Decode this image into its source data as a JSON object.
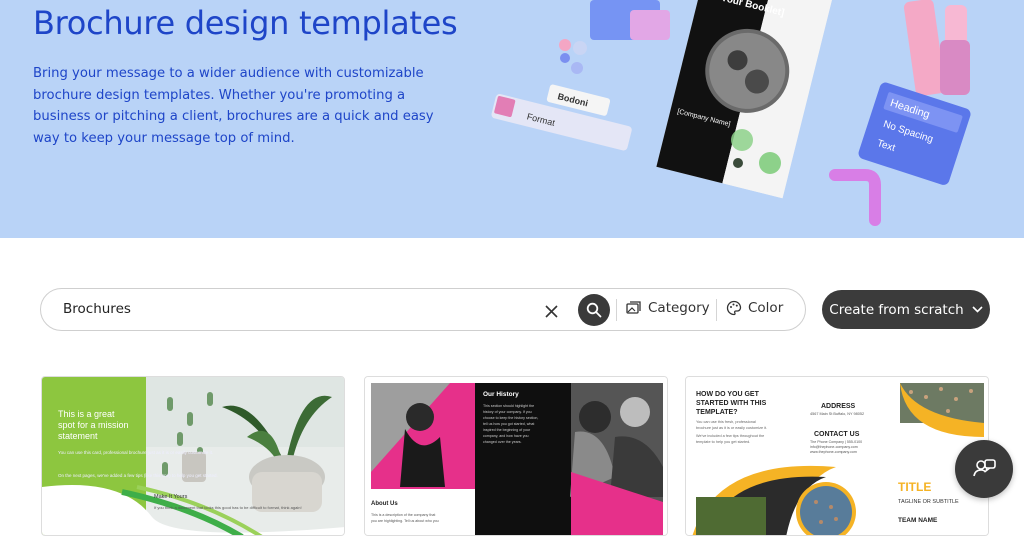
{
  "hero": {
    "title": "Brochure design templates",
    "description": "Bring your message to a wider audience with customizable brochure design templates. Whether you're promoting a business or pitching a client, brochures are a quick and easy way to keep your message top of mind.",
    "art": {
      "booklet_title": "of Your Booklet]",
      "company": "[Company Name]",
      "toolbar_label": "Format",
      "font_label": "Bodoni",
      "styles": [
        "Heading",
        "No Spacing",
        "Text"
      ]
    }
  },
  "search": {
    "value": "Brochures",
    "category_label": "Category",
    "color_label": "Color"
  },
  "create_button": "Create from scratch",
  "templates": [
    {
      "name": "green-brochure",
      "headline": "This is a great spot for a mission statement",
      "body": "You can use this card, professional brochure just as it is or easily customize it.",
      "body2": "On the next pages, we've added a few tips (like this one) to help you get started.",
      "caption": "Make It Yours",
      "caption_body": "If you think a document that looks this good has to be difficult to format, think again!"
    },
    {
      "name": "pink-black-brochure",
      "section1": "Our History",
      "section1_body": "This section should highlight the history of your company. If you choose to keep the history section, tell us how you got started, what inspired the beginning of your company, and how have you changed over the years.",
      "section2": "About Us",
      "section2_body": "This is a description of the company that you are highlighting. Tell us about who you"
    },
    {
      "name": "yellow-sports-brochure",
      "question": "HOW DO YOU GET STARTED WITH THIS TEMPLATE?",
      "question_body": "You can use this fresh, professional brochure just as it is or easily customize it.",
      "question_body2": "We've included a few tips throughout the template to help you get started.",
      "address_label": "ADDRESS",
      "address_value": "4567 Main St Buffalo, NY 98052",
      "contact_label": "CONTACT US",
      "contact_value": "The Phone Company | 555-0100 info@thephone-company.com www.thephone-company.com",
      "title": "TITLE",
      "tagline": "TAGLINE OR SUBTITLE",
      "team": "TEAM NAME"
    }
  ],
  "colors": {
    "hero_bg": "#b9d3f7",
    "brand_blue": "#1e45c8",
    "dark_button": "#3b3b3b",
    "green": "#8dc63f",
    "pink": "#e6308a",
    "yellow": "#f5b325"
  }
}
